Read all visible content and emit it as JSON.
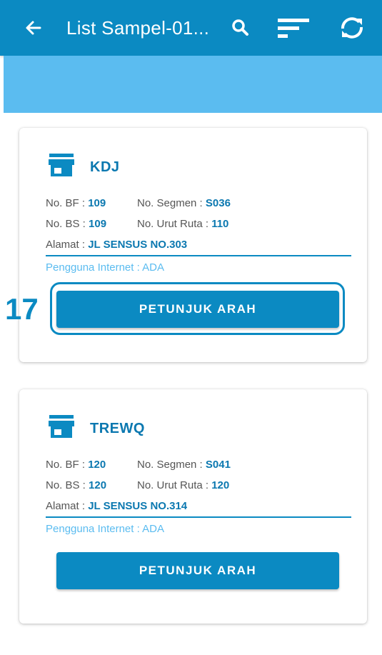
{
  "appbar": {
    "title": "List Sampel-01...",
    "back_icon": "arrow-left-icon",
    "search_icon": "search-icon",
    "sort_icon": "sort-icon",
    "sync_icon": "sync-icon"
  },
  "colors": {
    "primary": "#0b8ac2",
    "banner": "#5bbcf0",
    "value_text": "#0b78b0"
  },
  "step_annotation": "17",
  "cards": [
    {
      "name": "KDJ",
      "bf_label": "No. BF : ",
      "bf_value": "109",
      "segmen_label": "No. Segmen : ",
      "segmen_value": "S036",
      "bs_label": "No. BS : ",
      "bs_value": "109",
      "ruta_label": "No. Urut Ruta : ",
      "ruta_value": "110",
      "alamat_label": "Alamat : ",
      "alamat_value": "JL SENSUS NO.303",
      "internet": "Pengguna Internet : ADA",
      "button_label": "PETUNJUK ARAH"
    },
    {
      "name": "TREWQ",
      "bf_label": "No. BF : ",
      "bf_value": "120",
      "segmen_label": "No. Segmen : ",
      "segmen_value": "S041",
      "bs_label": "No. BS : ",
      "bs_value": "120",
      "ruta_label": "No. Urut Ruta : ",
      "ruta_value": "120",
      "alamat_label": "Alamat : ",
      "alamat_value": "JL SENSUS NO.314",
      "internet": "Pengguna Internet : ADA",
      "button_label": "PETUNJUK ARAH"
    }
  ]
}
